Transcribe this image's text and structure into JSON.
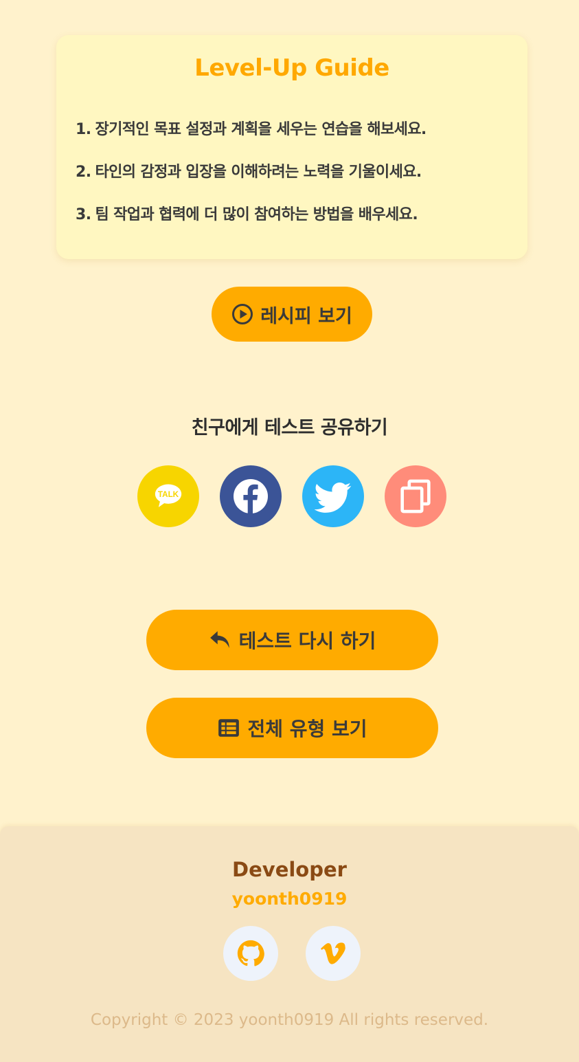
{
  "guide": {
    "title": "Level-Up Guide",
    "items": [
      {
        "num": "1.",
        "text": "장기적인 목표 설정과 계획을 세우는 연습을 해보세요."
      },
      {
        "num": "2.",
        "text": "타인의 감정과 입장을 이해하려는 노력을 기울이세요."
      },
      {
        "num": "3.",
        "text": "팀 작업과 협력에 더 많이 참여하는 방법을 배우세요."
      }
    ]
  },
  "recipe_button": {
    "label": "레시피 보기",
    "icon": "play-circle-icon"
  },
  "share": {
    "title": "친구에게 테스트 공유하기",
    "buttons": [
      {
        "name": "kakao",
        "icon": "kakaotalk-icon",
        "label": "TALK",
        "color": "#f7d500"
      },
      {
        "name": "facebook",
        "icon": "facebook-icon",
        "color": "#3b5497"
      },
      {
        "name": "twitter",
        "icon": "twitter-icon",
        "color": "#2cb5f7"
      },
      {
        "name": "copy-link",
        "icon": "copy-icon",
        "color": "#ff8c7a"
      }
    ]
  },
  "actions": {
    "retry_label": "테스트 다시 하기",
    "retry_icon": "reply-arrow-icon",
    "all_types_label": "전체 유형 보기",
    "all_types_icon": "table-list-icon"
  },
  "footer": {
    "developer_title": "Developer",
    "developer_handle": "yoonth0919",
    "links": [
      {
        "name": "github",
        "icon": "github-icon"
      },
      {
        "name": "vimeo",
        "icon": "vimeo-icon"
      }
    ],
    "copyright": "Copyright © 2023 yoonth0919 All rights reserved."
  },
  "colors": {
    "background": "#fff2cc",
    "accent": "#ffab00",
    "card": "#fff7c1",
    "footer_bg": "#f6e4c2",
    "developer_title": "#8a4a14"
  }
}
